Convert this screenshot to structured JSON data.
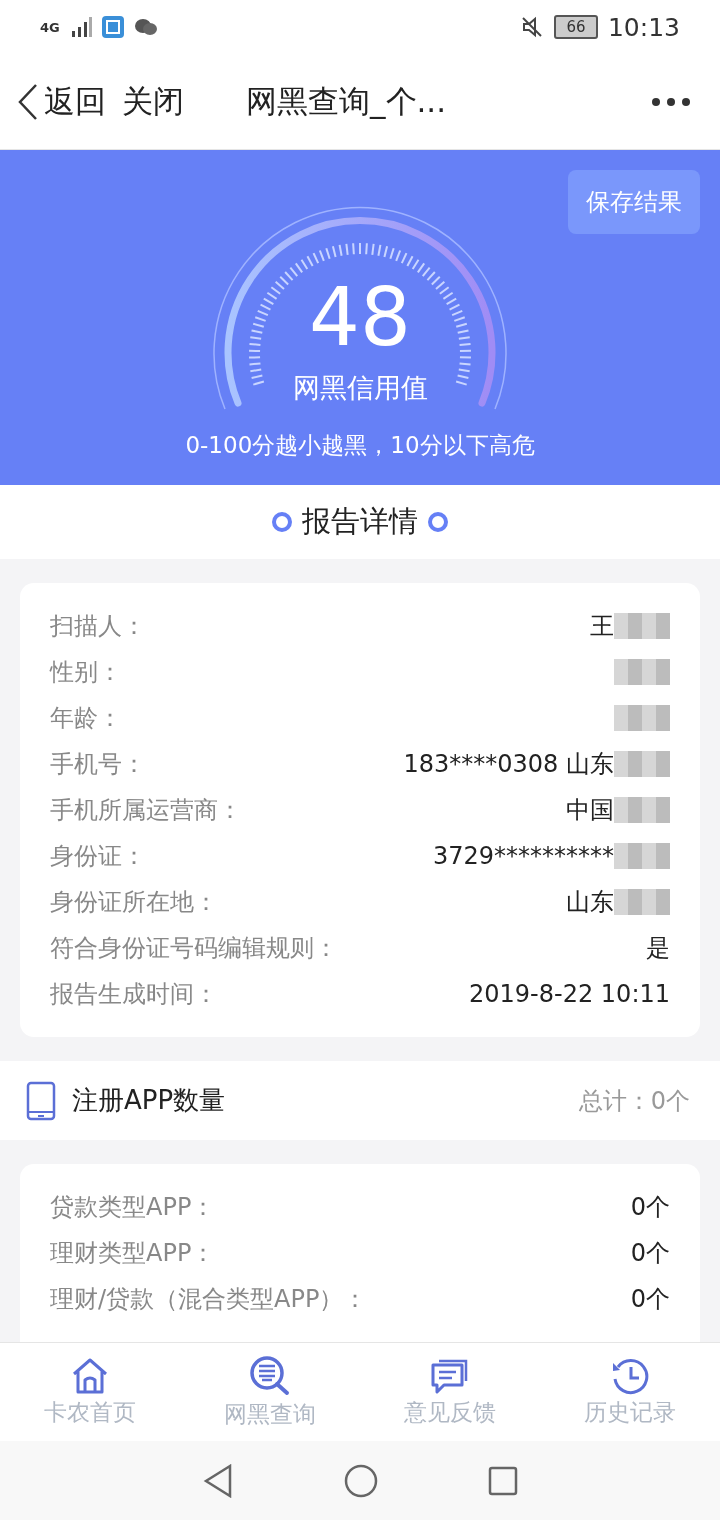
{
  "status_bar": {
    "network": "4G",
    "battery": "66",
    "time": "10:13"
  },
  "nav_bar": {
    "back": "返回",
    "close": "关闭",
    "title": "网黑查询_个..."
  },
  "score_panel": {
    "save_button": "保存结果",
    "score": "48",
    "label": "网黑信用值",
    "note": "0-100分越小越黑，10分以下高危"
  },
  "report_heading": "报告详情",
  "report_rows": [
    {
      "label": "扫描人：",
      "value": "王",
      "redacted": true
    },
    {
      "label": "性别：",
      "value": "",
      "redacted": true
    },
    {
      "label": "年龄：",
      "value": "",
      "redacted": true
    },
    {
      "label": "手机号：",
      "value": "183****0308 山东",
      "redacted": true
    },
    {
      "label": "手机所属运营商：",
      "value": "中国",
      "redacted": true
    },
    {
      "label": "身份证：",
      "value": "3729**********",
      "redacted": true
    },
    {
      "label": "身份证所在地：",
      "value": "山东",
      "redacted": true
    },
    {
      "label": "符合身份证号码编辑规则：",
      "value": "是",
      "redacted": false
    },
    {
      "label": "报告生成时间：",
      "value": "2019-8-22 10:11",
      "redacted": false
    }
  ],
  "app_section": {
    "title": "注册APP数量",
    "total": "总计：0个"
  },
  "app_rows": [
    {
      "label": "贷款类型APP：",
      "value": "0个"
    },
    {
      "label": "理财类型APP：",
      "value": "0个"
    },
    {
      "label": "理财/贷款（混合类型APP）：",
      "value": "0个"
    }
  ],
  "tab_bar": [
    {
      "kind": "home",
      "label": "卡农首页"
    },
    {
      "kind": "search",
      "label": "网黑查询"
    },
    {
      "kind": "feedback",
      "label": "意见反馈"
    },
    {
      "kind": "history",
      "label": "历史记录"
    }
  ]
}
